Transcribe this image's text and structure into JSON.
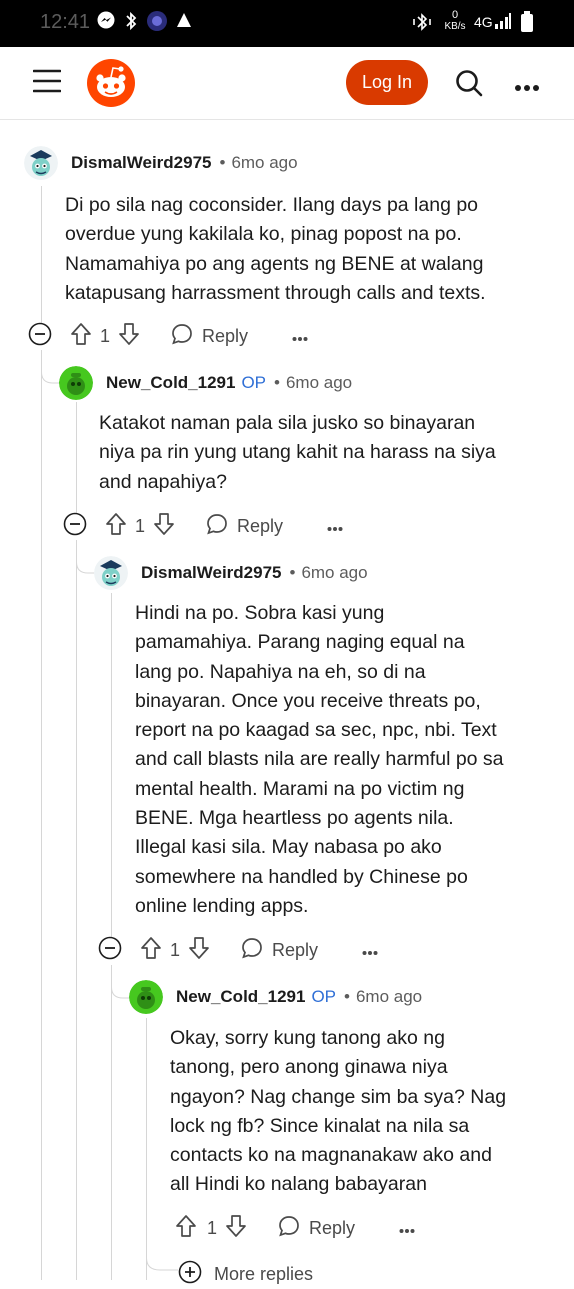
{
  "status_bar": {
    "time": "12:41",
    "network": "4G",
    "speed_value": "0",
    "speed_unit": "KB/s"
  },
  "header": {
    "login_label": "Log In"
  },
  "comments": [
    {
      "author": "DismalWeird2975",
      "op": "",
      "time": "6mo ago",
      "lines": [
        "Di po sila nag coconsider. Ilang days pa lang po",
        "overdue yung kakilala ko, pinag popost na po.",
        "Namamahiya po ang agents ng BENE at walang",
        "katapusang harrassment through calls and texts."
      ],
      "votes": "1",
      "reply_label": "Reply"
    },
    {
      "author": "New_Cold_1291",
      "op": "OP",
      "time": "6mo ago",
      "lines": [
        "Katakot naman pala sila jusko so binayaran",
        "niya pa rin yung utang kahit na harass na siya",
        "and napahiya?"
      ],
      "votes": "1",
      "reply_label": "Reply"
    },
    {
      "author": "DismalWeird2975",
      "op": "",
      "time": "6mo ago",
      "lines": [
        "Hindi na po. Sobra kasi yung",
        "pamamahiya. Parang naging equal na",
        "lang po. Napahiya na eh, so di na",
        "binayaran. Once you receive threats po,",
        "report na po kaagad sa sec, npc, nbi. Text",
        "and call blasts nila are really harmful po sa",
        "mental health. Marami na po victim ng",
        "BENE. Mga heartless po agents nila.",
        "Illegal kasi sila. May nabasa po ako",
        "somewhere na handled by Chinese po",
        "online lending apps."
      ],
      "votes": "1",
      "reply_label": "Reply"
    },
    {
      "author": "New_Cold_1291",
      "op": "OP",
      "time": "6mo ago",
      "lines": [
        "Okay, sorry kung tanong ako ng",
        "tanong, pero anong ginawa niya",
        "ngayon? Nag change sim ba sya? Nag",
        "lock ng fb? Since kinalat na nila sa",
        "contacts ko na magnanakaw ako and",
        "all Hindi ko nalang babayaran"
      ],
      "votes": "1",
      "reply_label": "Reply"
    }
  ],
  "more_replies_label": "More replies",
  "colors": {
    "brand": "#ff4500",
    "login": "#d93a00",
    "op": "#2f6fd6"
  }
}
